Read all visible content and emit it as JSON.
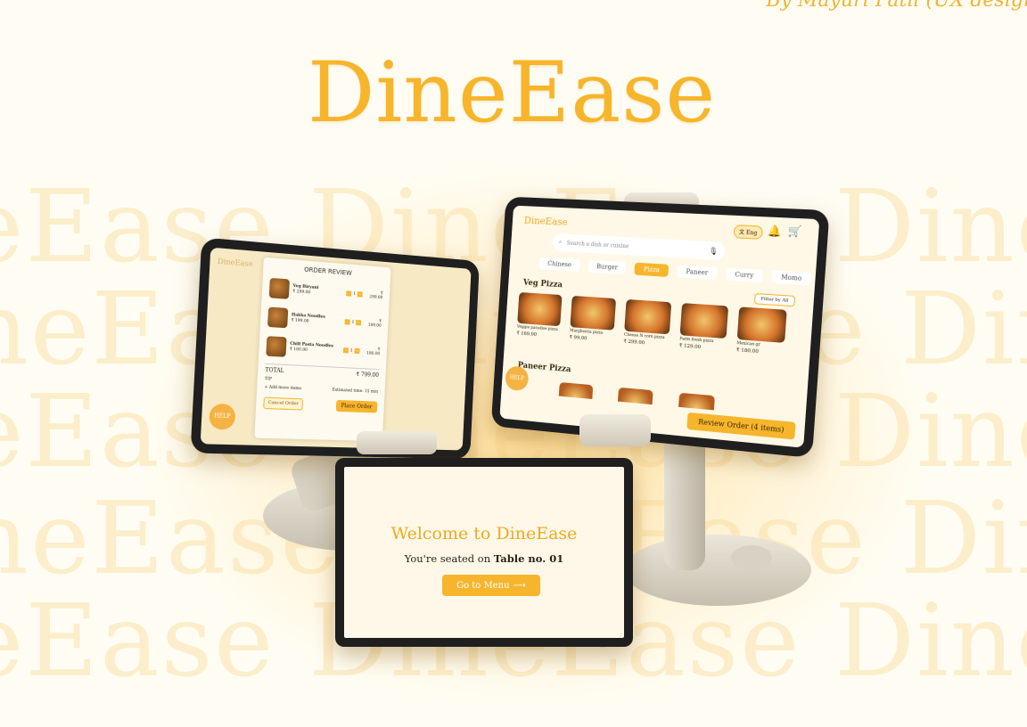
{
  "credit": "By Mayuri Patil (UX design",
  "brand": {
    "title": "DineEase"
  },
  "watermark": {
    "rows": [
      "eEase DineEase DineEase",
      "neEase DineEase DineEase",
      "eEase DineEase DineEase",
      "neEase DineEase DineEase",
      "eEase DineEase DineEase"
    ]
  },
  "order_review": {
    "title": "ORDER REVIEW",
    "items": [
      {
        "name": "Veg Biryani",
        "qty": "1",
        "price": "₹ 299.00"
      },
      {
        "name": "Hakka Noodles",
        "qty": "1",
        "price": "₹ 199.00"
      },
      {
        "name": "Chili Pasta Noodles",
        "qty": "1",
        "price": "₹ 180.00"
      }
    ],
    "total_label": "TOTAL",
    "total_value": "₹ 799.00",
    "tip_label": "TIP",
    "add_more": "+ Add more items",
    "estimated": "Estimated time: 15 min",
    "cancel_label": "Cancel Order",
    "place_label": "Place Order",
    "help_label": "HELP"
  },
  "menu": {
    "brand": "DineEase",
    "lang": "Eng",
    "search_placeholder": "Search a dish or cuisine",
    "categories": [
      "Chinese",
      "Burger",
      "Pizza",
      "Paneer",
      "Curry",
      "Momo"
    ],
    "active_category": "Pizza",
    "section_veg": "Veg Pizza",
    "section_paneer": "Paneer Pizza",
    "filter_label": "Filter by",
    "filter_value": "All",
    "dishes": [
      {
        "name": "Veggie paradise pizza",
        "price": "₹ 169.00"
      },
      {
        "name": "Margherita pizza",
        "price": "₹ 99.00"
      },
      {
        "name": "Cheese N corn pizza",
        "price": "₹ 299.00"
      },
      {
        "name": "Farm fresh pizza",
        "price": "₹ 129.00"
      },
      {
        "name": "Mexican gr",
        "price": "₹ 180.00"
      }
    ],
    "help_label": "HELP",
    "review_label": "Review Order (4 items)"
  },
  "welcome": {
    "title": "Welcome to DineEase",
    "seated_prefix": "You're seated on ",
    "table": "Table no. 01",
    "button_label": "Go to Menu"
  },
  "colors": {
    "accent": "#f7b52c",
    "background": "#fffdf3",
    "text": "#2a2418"
  }
}
